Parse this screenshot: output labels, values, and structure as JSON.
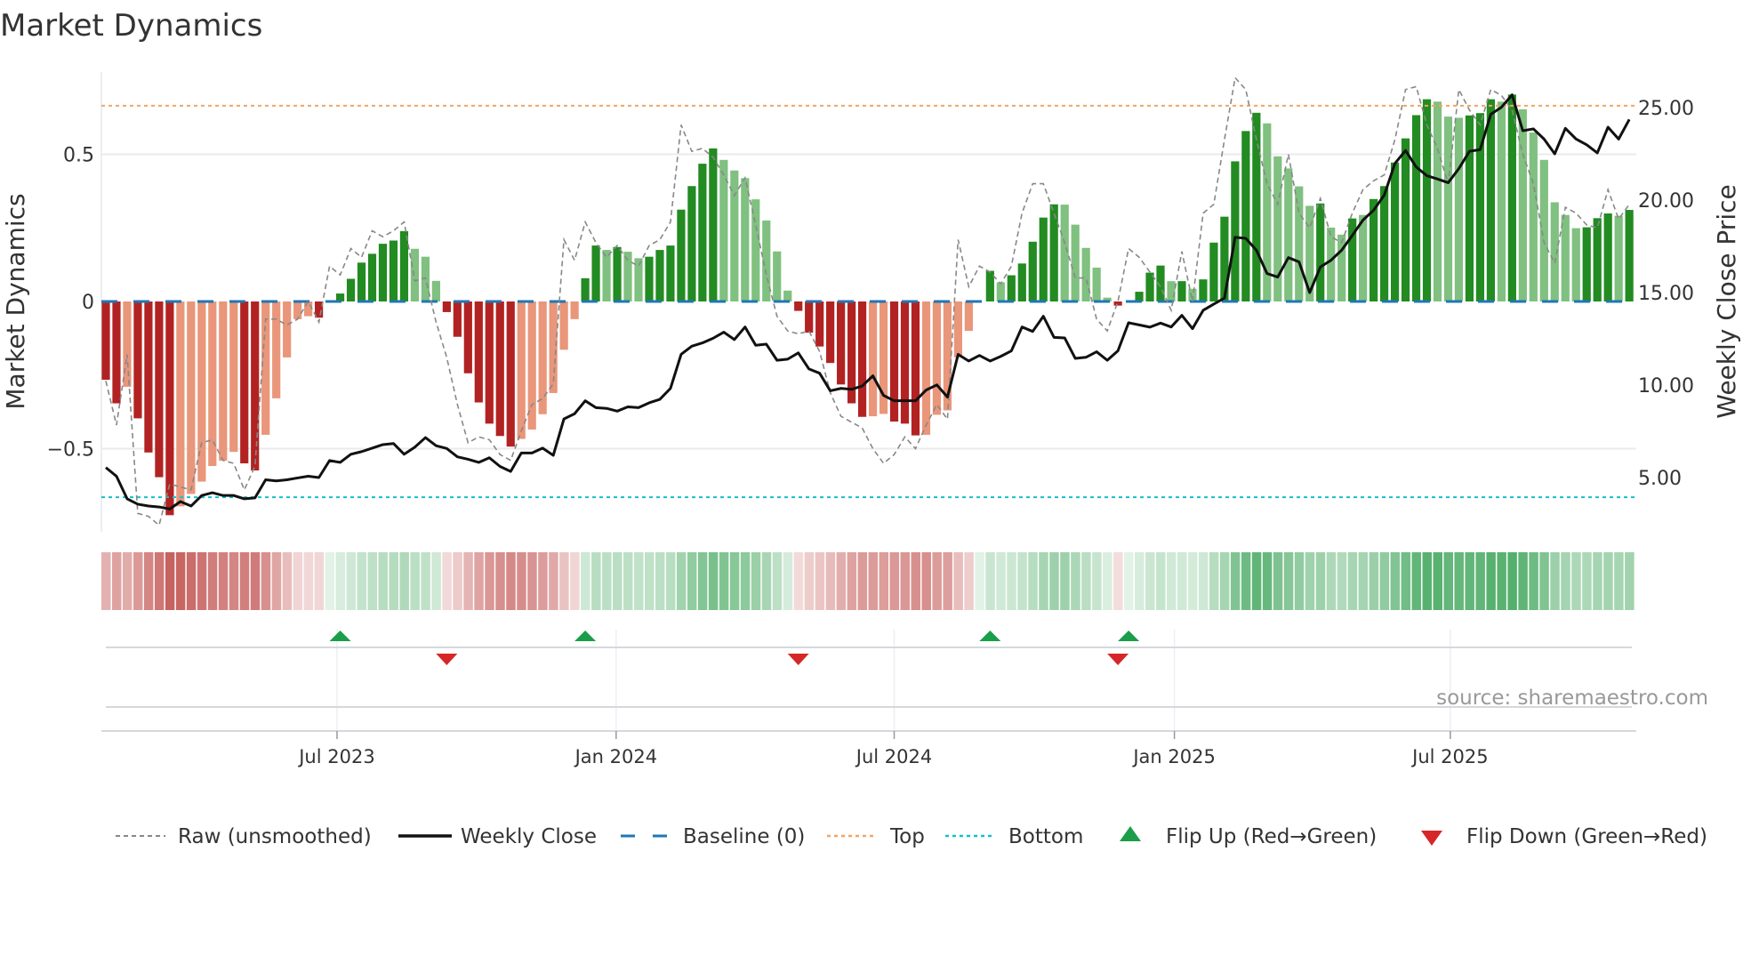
{
  "title": "Market Dynamics",
  "source": "source: sharemaestro.com",
  "colors": {
    "bar_pos_strong": "#228b22",
    "bar_pos_weak": "#80c080",
    "bar_neg_strong": "#b22222",
    "bar_neg_weak": "#e9967a",
    "raw": "#888888",
    "close": "#111111",
    "baseline": "#1f77b4",
    "top": "#f4a460",
    "bottom": "#17becf",
    "flip_up": "#1a9e4a",
    "flip_down": "#d62728",
    "strip_red": "#c0504d",
    "strip_green": "#3fa55a"
  },
  "legend": {
    "raw": "Raw (unsmoothed)",
    "close": "Weekly Close",
    "baseline": "Baseline (0)",
    "top": "Top",
    "bottom": "Bottom",
    "flip_up": "Flip Up (Red→Green)",
    "flip_down": "Flip Down (Green→Red)"
  },
  "chart_data": {
    "type": "bar",
    "title": "Market Dynamics",
    "ylabel": "Market Dynamics",
    "ylabel_right": "Weekly Close Price",
    "ylim": [
      -0.8,
      0.8
    ],
    "ylim_right": [
      1.8,
      27.5
    ],
    "yticks": [
      {
        "v": 0.5,
        "label": "0.5"
      },
      {
        "v": 0,
        "label": "0"
      },
      {
        "v": -0.5,
        "label": "−0.5"
      }
    ],
    "yticks_right": [
      {
        "v": 25,
        "label": "25.00"
      },
      {
        "v": 20,
        "label": "20.00"
      },
      {
        "v": 15,
        "label": "15.00"
      },
      {
        "v": 10,
        "label": "10.00"
      },
      {
        "v": 5,
        "label": "5.00"
      }
    ],
    "xticks": [
      {
        "week": 21.7,
        "label": "Jul 2023"
      },
      {
        "week": 47.9,
        "label": "Jan 2024"
      },
      {
        "week": 74.0,
        "label": "Jul 2024"
      },
      {
        "week": 100.3,
        "label": "Jan 2025"
      },
      {
        "week": 126.2,
        "label": "Jul 2025"
      }
    ],
    "top_level": 0.665,
    "bottom_level": -0.665,
    "baseline": 0,
    "values": [
      -0.266,
      -0.346,
      -0.29,
      -0.397,
      -0.513,
      -0.597,
      -0.726,
      -0.696,
      -0.654,
      -0.612,
      -0.559,
      -0.541,
      -0.511,
      -0.55,
      -0.574,
      -0.453,
      -0.329,
      -0.19,
      -0.06,
      -0.05,
      -0.055,
      0,
      0.027,
      0.077,
      0.132,
      0.162,
      0.196,
      0.207,
      0.239,
      0.179,
      0.152,
      0.07,
      -0.036,
      -0.12,
      -0.244,
      -0.343,
      -0.415,
      -0.457,
      -0.493,
      -0.467,
      -0.435,
      -0.383,
      -0.311,
      -0.164,
      -0.06,
      0.079,
      0.19,
      0.175,
      0.185,
      0.169,
      0.147,
      0.152,
      0.175,
      0.19,
      0.312,
      0.392,
      0.468,
      0.52,
      0.481,
      0.445,
      0.419,
      0.347,
      0.275,
      0.17,
      0.037,
      -0.032,
      -0.106,
      -0.153,
      -0.209,
      -0.282,
      -0.346,
      -0.392,
      -0.39,
      -0.382,
      -0.408,
      -0.415,
      -0.455,
      -0.453,
      -0.385,
      -0.37,
      -0.19,
      -0.1,
      0,
      0.104,
      0.065,
      0.089,
      0.129,
      0.203,
      0.285,
      0.33,
      0.329,
      0.261,
      0.182,
      0.115,
      0.013,
      -0.014,
      0,
      0.033,
      0.098,
      0.122,
      0.069,
      0.069,
      0.043,
      0.075,
      0.2,
      0.288,
      0.476,
      0.579,
      0.641,
      0.605,
      0.493,
      0.452,
      0.391,
      0.325,
      0.333,
      0.251,
      0.227,
      0.282,
      0.294,
      0.348,
      0.392,
      0.472,
      0.554,
      0.633,
      0.687,
      0.679,
      0.628,
      0.624,
      0.632,
      0.64,
      0.687,
      0.679,
      0.703,
      0.653,
      0.574,
      0.481,
      0.337,
      0.294,
      0.249,
      0.252,
      0.283,
      0.299,
      0.291,
      0.311
    ],
    "strengthening": [
      1,
      1,
      0,
      1,
      1,
      1,
      1,
      0,
      0,
      0,
      0,
      0,
      0,
      1,
      1,
      0,
      0,
      0,
      0,
      0,
      1,
      1,
      1,
      1,
      1,
      1,
      1,
      1,
      1,
      0,
      0,
      0,
      1,
      1,
      1,
      1,
      1,
      1,
      1,
      0,
      0,
      0,
      0,
      0,
      0,
      1,
      1,
      0,
      1,
      0,
      0,
      1,
      1,
      1,
      1,
      1,
      1,
      1,
      0,
      0,
      0,
      0,
      0,
      0,
      0,
      1,
      1,
      1,
      1,
      1,
      1,
      1,
      0,
      0,
      1,
      1,
      1,
      0,
      0,
      0,
      0,
      0,
      1,
      1,
      0,
      1,
      1,
      1,
      1,
      1,
      0,
      0,
      0,
      0,
      0,
      1,
      1,
      1,
      1,
      1,
      0,
      1,
      0,
      1,
      1,
      1,
      1,
      1,
      1,
      0,
      0,
      0,
      0,
      0,
      1,
      0,
      0,
      1,
      0,
      1,
      1,
      1,
      1,
      1,
      1,
      0,
      0,
      0,
      1,
      1,
      1,
      0,
      1,
      0,
      0,
      0,
      0,
      0,
      0,
      1,
      1,
      1,
      0,
      1
    ],
    "raw": [
      -0.27,
      -0.42,
      -0.18,
      -0.72,
      -0.73,
      -0.76,
      -0.62,
      -0.63,
      -0.64,
      -0.48,
      -0.47,
      -0.54,
      -0.55,
      -0.64,
      -0.56,
      -0.06,
      -0.06,
      -0.08,
      -0.06,
      0,
      -0.07,
      0.12,
      0.09,
      0.18,
      0.15,
      0.24,
      0.22,
      0.24,
      0.27,
      0.07,
      0.08,
      -0.07,
      -0.19,
      -0.35,
      -0.48,
      -0.46,
      -0.47,
      -0.52,
      -0.54,
      -0.44,
      -0.35,
      -0.33,
      -0.28,
      0.21,
      0.14,
      0.27,
      0.2,
      0.15,
      0.19,
      0.14,
      0.12,
      0.19,
      0.21,
      0.27,
      0.6,
      0.51,
      0.52,
      0.49,
      0.43,
      0.36,
      0.42,
      0.26,
      0.09,
      -0.05,
      -0.1,
      -0.11,
      -0.1,
      -0.17,
      -0.31,
      -0.39,
      -0.41,
      -0.43,
      -0.5,
      -0.55,
      -0.52,
      -0.46,
      -0.5,
      -0.42,
      -0.35,
      -0.4,
      0.21,
      0.05,
      0.12,
      0.1,
      0.06,
      0.12,
      0.3,
      0.4,
      0.4,
      0.3,
      0.2,
      0.08,
      0.08,
      -0.06,
      -0.1,
      0.0,
      0.18,
      0.15,
      0.1,
      0.05,
      -0.03,
      0.17,
      0.0,
      0.3,
      0.33,
      0.55,
      0.76,
      0.72,
      0.55,
      0.4,
      0.33,
      0.5,
      0.3,
      0.25,
      0.35,
      0.22,
      0.2,
      0.3,
      0.38,
      0.41,
      0.43,
      0.55,
      0.72,
      0.73,
      0.6,
      0.52,
      0.4,
      0.72,
      0.65,
      0.6,
      0.72,
      0.7,
      0.65,
      0.5,
      0.4,
      0.2,
      0.13,
      0.32,
      0.3,
      0.26,
      0.25,
      0.38,
      0.28,
      0.33
    ],
    "close": [
      5.54,
      5.07,
      3.85,
      3.56,
      3.46,
      3.41,
      3.3,
      3.7,
      3.46,
      4.03,
      4.18,
      4.03,
      4.03,
      3.85,
      3.9,
      4.88,
      4.82,
      4.88,
      4.98,
      5.07,
      5.0,
      5.92,
      5.82,
      6.26,
      6.4,
      6.59,
      6.78,
      6.84,
      6.26,
      6.64,
      7.16,
      6.72,
      6.57,
      6.12,
      5.99,
      5.82,
      6.07,
      5.6,
      5.33,
      6.33,
      6.33,
      6.59,
      6.2,
      8.17,
      8.45,
      9.15,
      8.78,
      8.74,
      8.59,
      8.82,
      8.78,
      9.04,
      9.23,
      9.82,
      11.66,
      12.1,
      12.28,
      12.53,
      12.86,
      12.46,
      13.14,
      12.15,
      12.21,
      11.34,
      11.4,
      11.74,
      10.87,
      10.64,
      9.69,
      9.82,
      9.77,
      9.95,
      10.5,
      9.44,
      9.15,
      9.15,
      9.15,
      9.73,
      10.01,
      9.35,
      11.66,
      11.3,
      11.6,
      11.3,
      11.55,
      11.85,
      13.14,
      12.9,
      13.72,
      12.58,
      12.55,
      11.44,
      11.5,
      11.8,
      11.34,
      11.85,
      13.37,
      13.25,
      13.13,
      13.35,
      13.14,
      13.77,
      13.05,
      14.04,
      14.38,
      14.7,
      17.99,
      17.93,
      17.29,
      16.03,
      15.84,
      16.89,
      16.66,
      15.0,
      16.38,
      16.75,
      17.29,
      18.09,
      18.92,
      19.45,
      20.27,
      21.98,
      22.68,
      21.79,
      21.32,
      21.14,
      20.94,
      21.7,
      22.64,
      22.73,
      24.64,
      25.02,
      25.69,
      23.75,
      23.85,
      23.3,
      22.5,
      23.88,
      23.3,
      22.99,
      22.55,
      23.94,
      23.3,
      24.36
    ],
    "flip_up_weeks": [
      22,
      45,
      83,
      96
    ],
    "flip_down_weeks": [
      32,
      65,
      95
    ],
    "legend_position": "bottom"
  }
}
